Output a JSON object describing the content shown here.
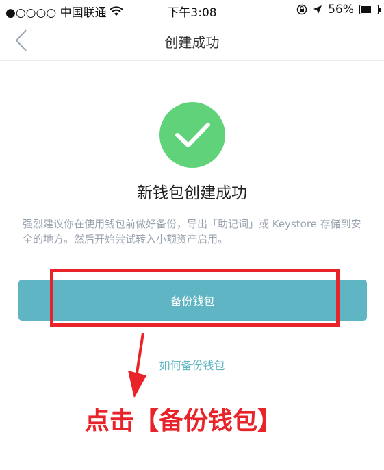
{
  "status_bar": {
    "carrier": "●○○○○ 中国联通",
    "time": "下午3:08",
    "battery": "56%"
  },
  "nav": {
    "title": "创建成功"
  },
  "main": {
    "title": "新钱包创建成功",
    "description": "强烈建议你在使用钱包前做好备份，导出「助记词」或 Keystore 存储到安全的地方。然后开始尝试转入小额资产启用。",
    "backup_button": "备份钱包",
    "how_to_link": "如何备份钱包"
  },
  "annotation": {
    "text": "点击【备份钱包】"
  },
  "colors": {
    "success_green": "#5fd27a",
    "button_teal": "#5fb5c3",
    "annotation_red": "#e8232a"
  }
}
